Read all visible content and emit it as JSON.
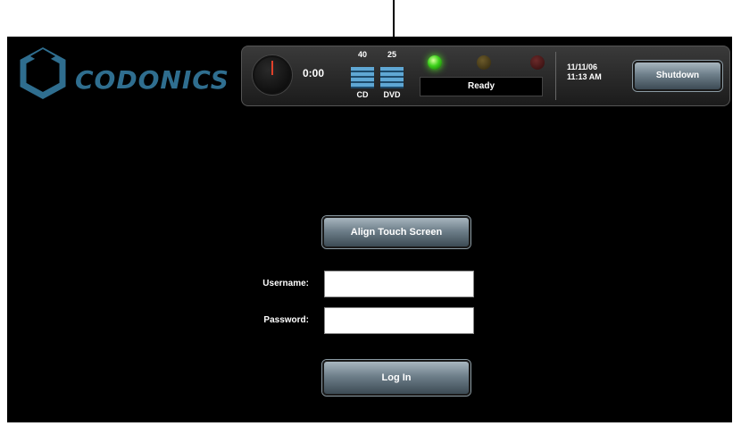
{
  "logo": {
    "text": "CODONICS"
  },
  "status_panel": {
    "timer": "0:00",
    "cd": {
      "count": "40",
      "label": "CD"
    },
    "dvd": {
      "count": "25",
      "label": "DVD"
    },
    "status_text": "Ready",
    "date": "11/11/06",
    "time": "11:13 AM",
    "shutdown_label": "Shutdown",
    "led_colors": {
      "green": "#3bd21a",
      "amber": "#2e250c",
      "red": "#2e0c0c"
    }
  },
  "login": {
    "align_button_label": "Align Touch Screen",
    "username_label": "Username:",
    "username_value": "",
    "password_label": "Password:",
    "password_value": "",
    "login_button_label": "Log In"
  }
}
